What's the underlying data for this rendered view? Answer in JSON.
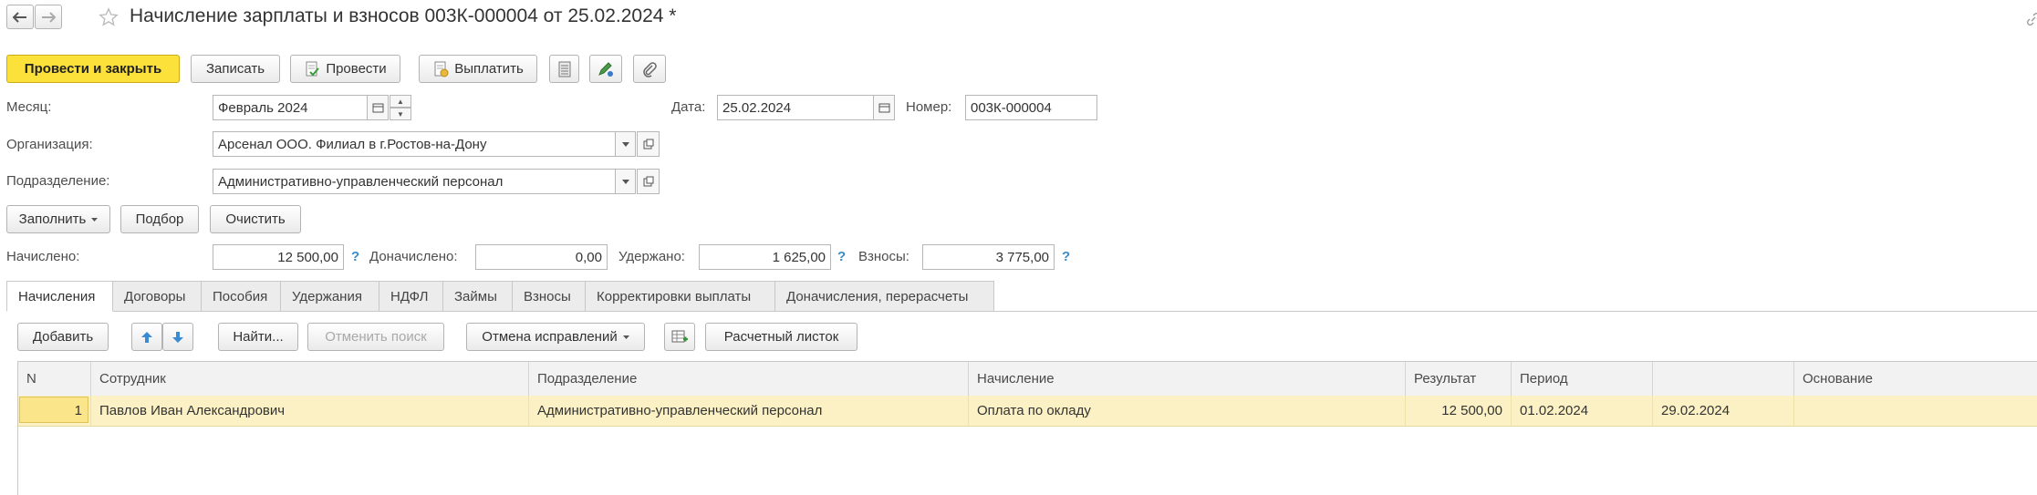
{
  "header": {
    "title": "Начисление зарплаты и взносов 003К-000004 от 25.02.2024 *"
  },
  "toolbar": {
    "post_close": "Провести и закрыть",
    "save": "Записать",
    "post": "Провести",
    "pay": "Выплатить"
  },
  "form": {
    "month_label": "Месяц:",
    "month_value": "Февраль 2024",
    "date_label": "Дата:",
    "date_value": "25.02.2024",
    "number_label": "Номер:",
    "number_value": "003К-000004",
    "org_label": "Организация:",
    "org_value": "Арсенал ООО. Филиал в г.Ростов-на-Дону",
    "dept_label": "Подразделение:",
    "dept_value": "Административно-управленческий персонал"
  },
  "actions": {
    "fill": "Заполнить",
    "pick": "Подбор",
    "clear": "Очистить"
  },
  "totals": {
    "accrued_label": "Начислено:",
    "accrued_value": "12 500,00",
    "additional_label": "Доначислено:",
    "additional_value": "0,00",
    "withheld_label": "Удержано:",
    "withheld_value": "1 625,00",
    "contrib_label": "Взносы:",
    "contrib_value": "3 775,00",
    "help": "?"
  },
  "tabs": [
    "Начисления",
    "Договоры",
    "Пособия",
    "Удержания",
    "НДФЛ",
    "Займы",
    "Взносы",
    "Корректировки выплаты",
    "Доначисления, перерасчеты"
  ],
  "table_toolbar": {
    "add": "Добавить",
    "find": "Найти...",
    "cancel_search": "Отменить поиск",
    "cancel_corrections": "Отмена исправлений",
    "payslip": "Расчетный листок"
  },
  "table": {
    "columns": [
      "N",
      "Сотрудник",
      "Подразделение",
      "Начисление",
      "Результат",
      "Период",
      "",
      "Основание"
    ],
    "rows": [
      [
        "1",
        "Павлов Иван Александрович",
        "Административно-управленческий персонал",
        "Оплата по окладу",
        "12 500,00",
        "01.02.2024",
        "29.02.2024",
        ""
      ]
    ]
  },
  "colors": {
    "primary_button": "#fbe13a",
    "selected_row": "#fbf1c4",
    "help": "#3a8bc8"
  }
}
